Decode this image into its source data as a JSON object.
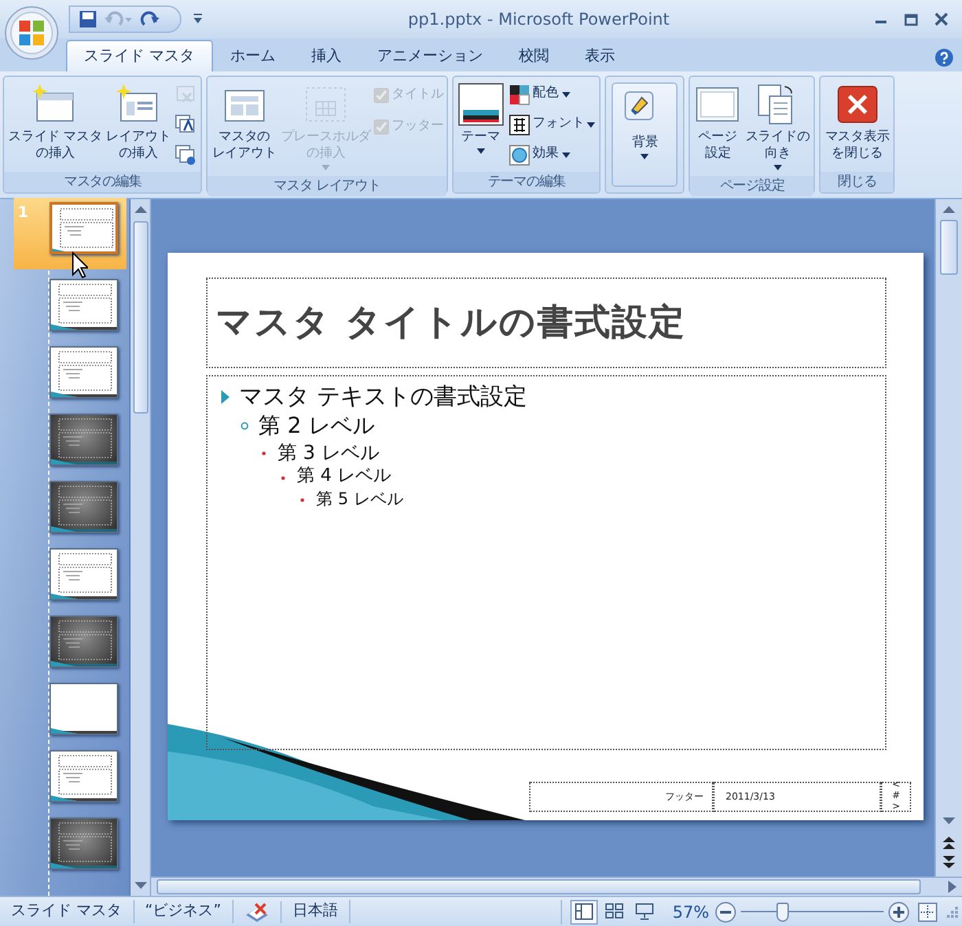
{
  "window": {
    "title": "pp1.pptx - Microsoft PowerPoint"
  },
  "tabs": [
    {
      "label": "スライド マスタ",
      "selected": true
    },
    {
      "label": "ホーム",
      "selected": false
    },
    {
      "label": "挿入",
      "selected": false
    },
    {
      "label": "アニメーション",
      "selected": false
    },
    {
      "label": "校閲",
      "selected": false
    },
    {
      "label": "表示",
      "selected": false
    }
  ],
  "ribbon_groups": [
    {
      "label": "マスタの編集",
      "items": [
        {
          "kind": "large",
          "lines": [
            "スライド マスタ",
            "の挿入"
          ],
          "disabled": false,
          "dropdown": false
        },
        {
          "kind": "large",
          "lines": [
            "レイアウト",
            "の挿入"
          ],
          "disabled": false,
          "dropdown": false
        },
        {
          "kind": "icon",
          "disabled": true
        },
        {
          "kind": "icon",
          "disabled": false
        },
        {
          "kind": "icon",
          "disabled": false
        }
      ]
    },
    {
      "label": "マスタ レイアウト",
      "items": [
        {
          "kind": "large",
          "lines": [
            "マスタの",
            "レイアウト"
          ],
          "disabled": false,
          "dropdown": false
        },
        {
          "kind": "large",
          "lines": [
            "プレースホルダ",
            "の挿入"
          ],
          "disabled": true,
          "dropdown": true
        },
        {
          "kind": "check",
          "label": "タイトル",
          "checked": true,
          "disabled": true
        },
        {
          "kind": "check",
          "label": "フッター",
          "checked": true,
          "disabled": true
        }
      ]
    },
    {
      "label": "テーマの編集",
      "items": [
        {
          "kind": "large",
          "lines": [
            "テーマ"
          ],
          "disabled": false,
          "dropdown": true
        },
        {
          "kind": "small",
          "label": "配色",
          "disabled": false,
          "dropdown": true
        },
        {
          "kind": "small",
          "label": "フォント",
          "disabled": false,
          "dropdown": true
        },
        {
          "kind": "small",
          "label": "効果",
          "disabled": false,
          "dropdown": true
        }
      ]
    },
    {
      "items": [
        {
          "kind": "large",
          "lines": [
            "背景"
          ],
          "disabled": false,
          "dropdown": true
        }
      ]
    },
    {
      "label": "ページ設定",
      "items": [
        {
          "kind": "large",
          "lines": [
            "ページ",
            "設定"
          ],
          "disabled": false,
          "dropdown": false
        },
        {
          "kind": "large",
          "lines": [
            "スライドの",
            "向き"
          ],
          "disabled": false,
          "dropdown": true
        }
      ]
    },
    {
      "label": "閉じる",
      "items": [
        {
          "kind": "large",
          "lines": [
            "マスタ表示",
            "を閉じる"
          ],
          "disabled": false,
          "dropdown": false
        }
      ]
    }
  ],
  "thumbnails": [
    {
      "number": "1",
      "selected": true,
      "kind": "light"
    },
    {
      "selected": false,
      "kind": "light"
    },
    {
      "selected": false,
      "kind": "light"
    },
    {
      "selected": false,
      "kind": "dark"
    },
    {
      "selected": false,
      "kind": "dark"
    },
    {
      "selected": false,
      "kind": "light"
    },
    {
      "selected": false,
      "kind": "dark"
    },
    {
      "selected": false,
      "kind": "blank"
    },
    {
      "selected": false,
      "kind": "light"
    },
    {
      "selected": false,
      "kind": "dark"
    }
  ],
  "slide": {
    "title": "マスタ タイトルの書式設定",
    "bullets": [
      {
        "text": "マスタ テキストの書式設定",
        "children": [
          {
            "text": "第 2 レベル",
            "children": [
              {
                "text": "第 3 レベル",
                "children": [
                  {
                    "text": "第 4 レベル",
                    "children": [
                      {
                        "text": "第 5 レベル"
                      }
                    ]
                  }
                ]
              }
            ]
          }
        ]
      }
    ],
    "footer": "フッター",
    "date": "2011/3/13",
    "page_number": "<#>"
  },
  "status_bar": {
    "items": [
      {
        "kind": "text",
        "text": "スライド マスタ"
      },
      {
        "kind": "text",
        "text": "“ビジネス”"
      },
      {
        "kind": "icon"
      },
      {
        "kind": "text",
        "text": "日本語"
      }
    ],
    "views": [
      {
        "selected": true
      },
      {
        "selected": false
      },
      {
        "selected": false
      }
    ],
    "zoom": "57%",
    "zoom_slider": {
      "level": 0.3
    }
  }
}
